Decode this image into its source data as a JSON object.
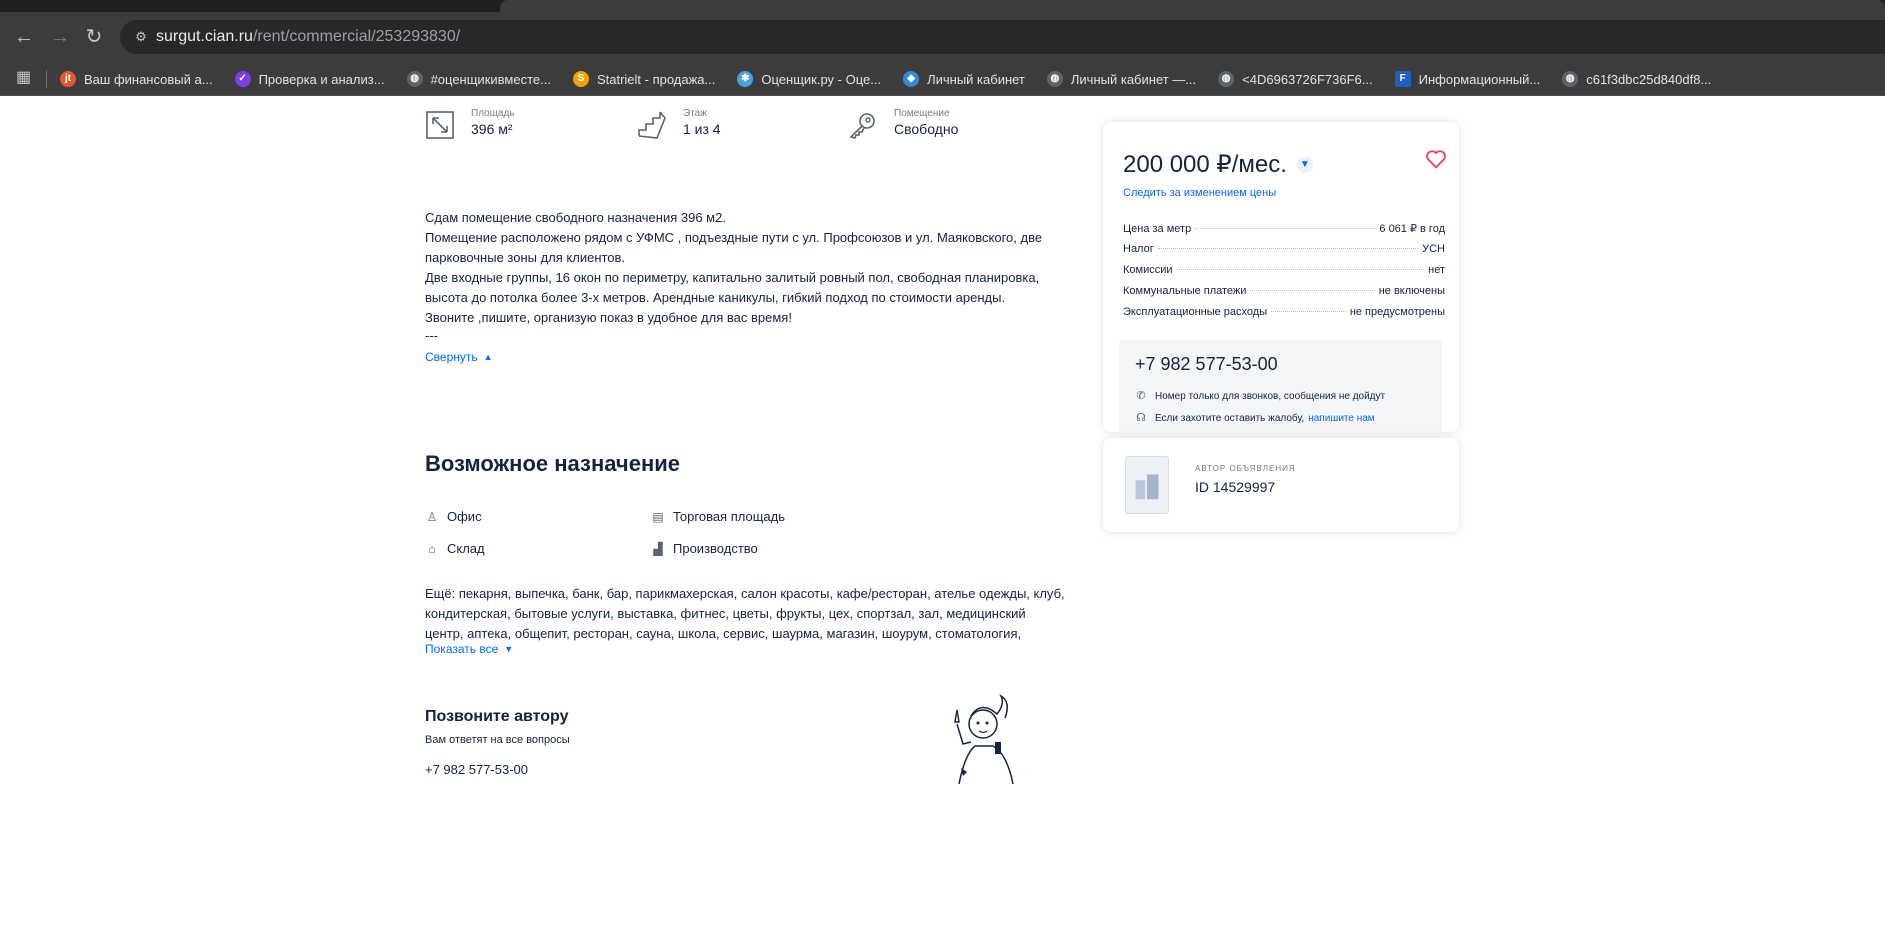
{
  "browser": {
    "url_host": "surgut.cian.ru",
    "url_path": "/rent/commercial/253293830/",
    "bookmarks": [
      {
        "label": "Ваш финансовый а...",
        "icon": "jt-icon",
        "color": "#e4572e"
      },
      {
        "label": "Проверка и анализ...",
        "icon": "check-icon",
        "color": "#7b3fe4"
      },
      {
        "label": "#оценщикивместе...",
        "icon": "globe-icon",
        "color": "#5f6368"
      },
      {
        "label": "Statrielt - продажа...",
        "icon": "statrielt-icon",
        "color": "#f0a500"
      },
      {
        "label": "Оценщик.ру - Оце...",
        "icon": "snowflake-icon",
        "color": "#4aa3df"
      },
      {
        "label": "Личный кабинет",
        "icon": "shield-icon",
        "color": "#2e8bd8"
      },
      {
        "label": "Личный кабинет —...",
        "icon": "globe-icon",
        "color": "#5f6368"
      },
      {
        "label": "<4D6963726F736F6...",
        "icon": "globe-icon",
        "color": "#5f6368"
      },
      {
        "label": "Информационный...",
        "icon": "foo-icon",
        "color": "#1f5fbf"
      },
      {
        "label": "c61f3dbc25d840df8...",
        "icon": "globe-icon",
        "color": "#5f6368"
      }
    ]
  },
  "stats": {
    "area": {
      "label": "Площадь",
      "value": "396 м²"
    },
    "floor": {
      "label": "Этаж",
      "value": "1 из 4"
    },
    "room": {
      "label": "Помещение",
      "value": "Свободно"
    }
  },
  "description": {
    "lines": [
      "Сдам помещение свободного назначения 396 м2.",
      "Помещение расположено рядом с УФМС , подъездные пути с ул. Профсоюзов и ул. Маяковского, две",
      "парковочные зоны для клиентов.",
      "Две входные группы, 16 окон по периметру, капитально залитый ровный пол, свободная планировка,",
      "высота до потолка более 3-х метров. Арендные каникулы, гибкий подход по стоимости аренды.",
      "Звоните ,пишите, организую показ в удобное для вас время!"
    ],
    "dash": "---",
    "collapse_label": "Свернуть"
  },
  "purpose": {
    "title": "Возможное назначение",
    "items": [
      {
        "label": "Офис",
        "icon": "office-icon"
      },
      {
        "label": "Торговая площадь",
        "icon": "shop-icon"
      },
      {
        "label": "Склад",
        "icon": "warehouse-icon"
      },
      {
        "label": "Производство",
        "icon": "factory-icon"
      }
    ],
    "more_lines": [
      "Ещё: пекарня, выпечка, банк, бар, парикмахерская, салон красоты, кафе/ресторан, ателье одежды, клуб,",
      "кондитерская, бытовые услуги, выставка, фитнес, цветы, фрукты, цех, спортзал, зал, медицинский",
      "центр, аптека, общепит, ресторан, сауна, школа, сервис, шаурма, магазин, шоурум, стоматология,"
    ],
    "show_all_label": "Показать все"
  },
  "call_author": {
    "title": "Позвоните автору",
    "subtitle": "Вам ответят на все вопросы",
    "phone": "+7 982 577-53-00"
  },
  "price_card": {
    "price": "200 000 ₽/мес.",
    "watch_label": "Следить за изменением цены",
    "terms": [
      {
        "key": "Цена за метр",
        "value": "6 061 ₽ в год"
      },
      {
        "key": "Налог",
        "value": "УСН"
      },
      {
        "key": "Комиссии",
        "value": "нет"
      },
      {
        "key": "Коммунальные платежи",
        "value": "не включены"
      },
      {
        "key": "Эксплуатационные расходы",
        "value": "не предусмотрены"
      }
    ],
    "phone": "+7 982 577-53-00",
    "note_calls": "Номер только для звонков, сообщения не дойдут",
    "note_complaint": "Если захотите оставить жалобу,",
    "note_complaint_link": "напишите нам"
  },
  "author": {
    "role": "АВТОР ОБЪЯВЛЕНИЯ",
    "id": "ID 14529997"
  },
  "colors": {
    "accent": "#0468ff",
    "text": "#152242",
    "favorite": "#e84260"
  }
}
